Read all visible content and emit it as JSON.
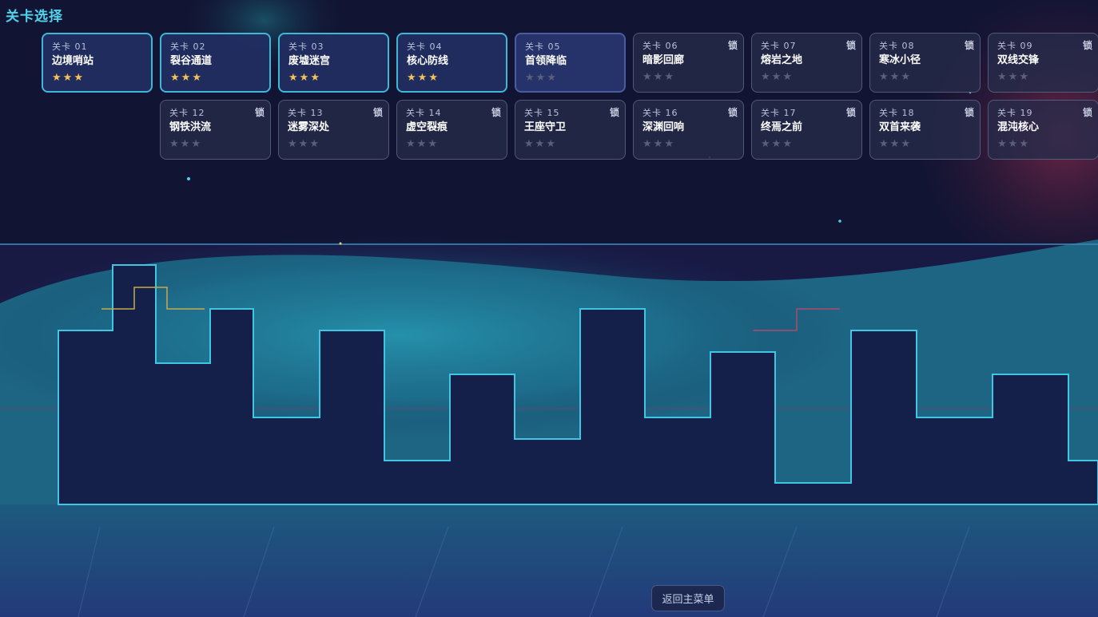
{
  "page": {
    "title": "关卡选择"
  },
  "levels_row1": [
    {
      "num": "关卡 01",
      "name": "边境哨站",
      "stars": 3,
      "locked": false,
      "state": "unlocked"
    },
    {
      "num": "关卡 02",
      "name": "裂谷通道",
      "stars": 3,
      "locked": false,
      "state": "unlocked"
    },
    {
      "num": "关卡 03",
      "name": "废墟迷宫",
      "stars": 3,
      "locked": false,
      "state": "unlocked"
    },
    {
      "num": "关卡 04",
      "name": "核心防线",
      "stars": 3,
      "locked": false,
      "state": "unlocked"
    },
    {
      "num": "关卡 05",
      "name": "首领降临",
      "stars": 0,
      "locked": false,
      "state": "current"
    },
    {
      "num": "关卡 06",
      "name": "暗影回廊",
      "stars": 0,
      "locked": true,
      "state": "locked"
    },
    {
      "num": "关卡 07",
      "name": "熔岩之地",
      "stars": 0,
      "locked": true,
      "state": "locked"
    },
    {
      "num": "关卡 08",
      "name": "寒冰小径",
      "stars": 0,
      "locked": true,
      "state": "locked"
    },
    {
      "num": "关卡 09",
      "name": "双线交锋",
      "stars": 0,
      "locked": true,
      "state": "locked"
    }
  ],
  "levels_row2": [
    {
      "num": "关卡 12",
      "name": "钢铁洪流",
      "stars": 0,
      "locked": true,
      "state": "locked"
    },
    {
      "num": "关卡 13",
      "name": "迷雾深处",
      "stars": 0,
      "locked": true,
      "state": "locked"
    },
    {
      "num": "关卡 14",
      "name": "虚空裂痕",
      "stars": 0,
      "locked": true,
      "state": "locked"
    },
    {
      "num": "关卡 15",
      "name": "王座守卫",
      "stars": 0,
      "locked": true,
      "state": "locked"
    },
    {
      "num": "关卡 16",
      "name": "深渊回响",
      "stars": 0,
      "locked": true,
      "state": "locked"
    },
    {
      "num": "关卡 17",
      "name": "终焉之前",
      "stars": 0,
      "locked": true,
      "state": "locked"
    },
    {
      "num": "关卡 18",
      "name": "双首来袭",
      "stars": 0,
      "locked": true,
      "state": "locked"
    },
    {
      "num": "关卡 19",
      "name": "混沌核心",
      "stars": 0,
      "locked": true,
      "state": "locked"
    }
  ],
  "lock_label": "锁",
  "star_glyph": "★",
  "back_button": {
    "label": "返回主菜单"
  },
  "colors": {
    "accent": "#4fd3ec",
    "star_on": "#f4c25a",
    "star_off": "#5a6078",
    "skyline_stroke": "#3fc6e3",
    "skyline_fill": "#14204a",
    "glow_teal": "#2aa9bf",
    "glow_red": "#8a2a48"
  }
}
